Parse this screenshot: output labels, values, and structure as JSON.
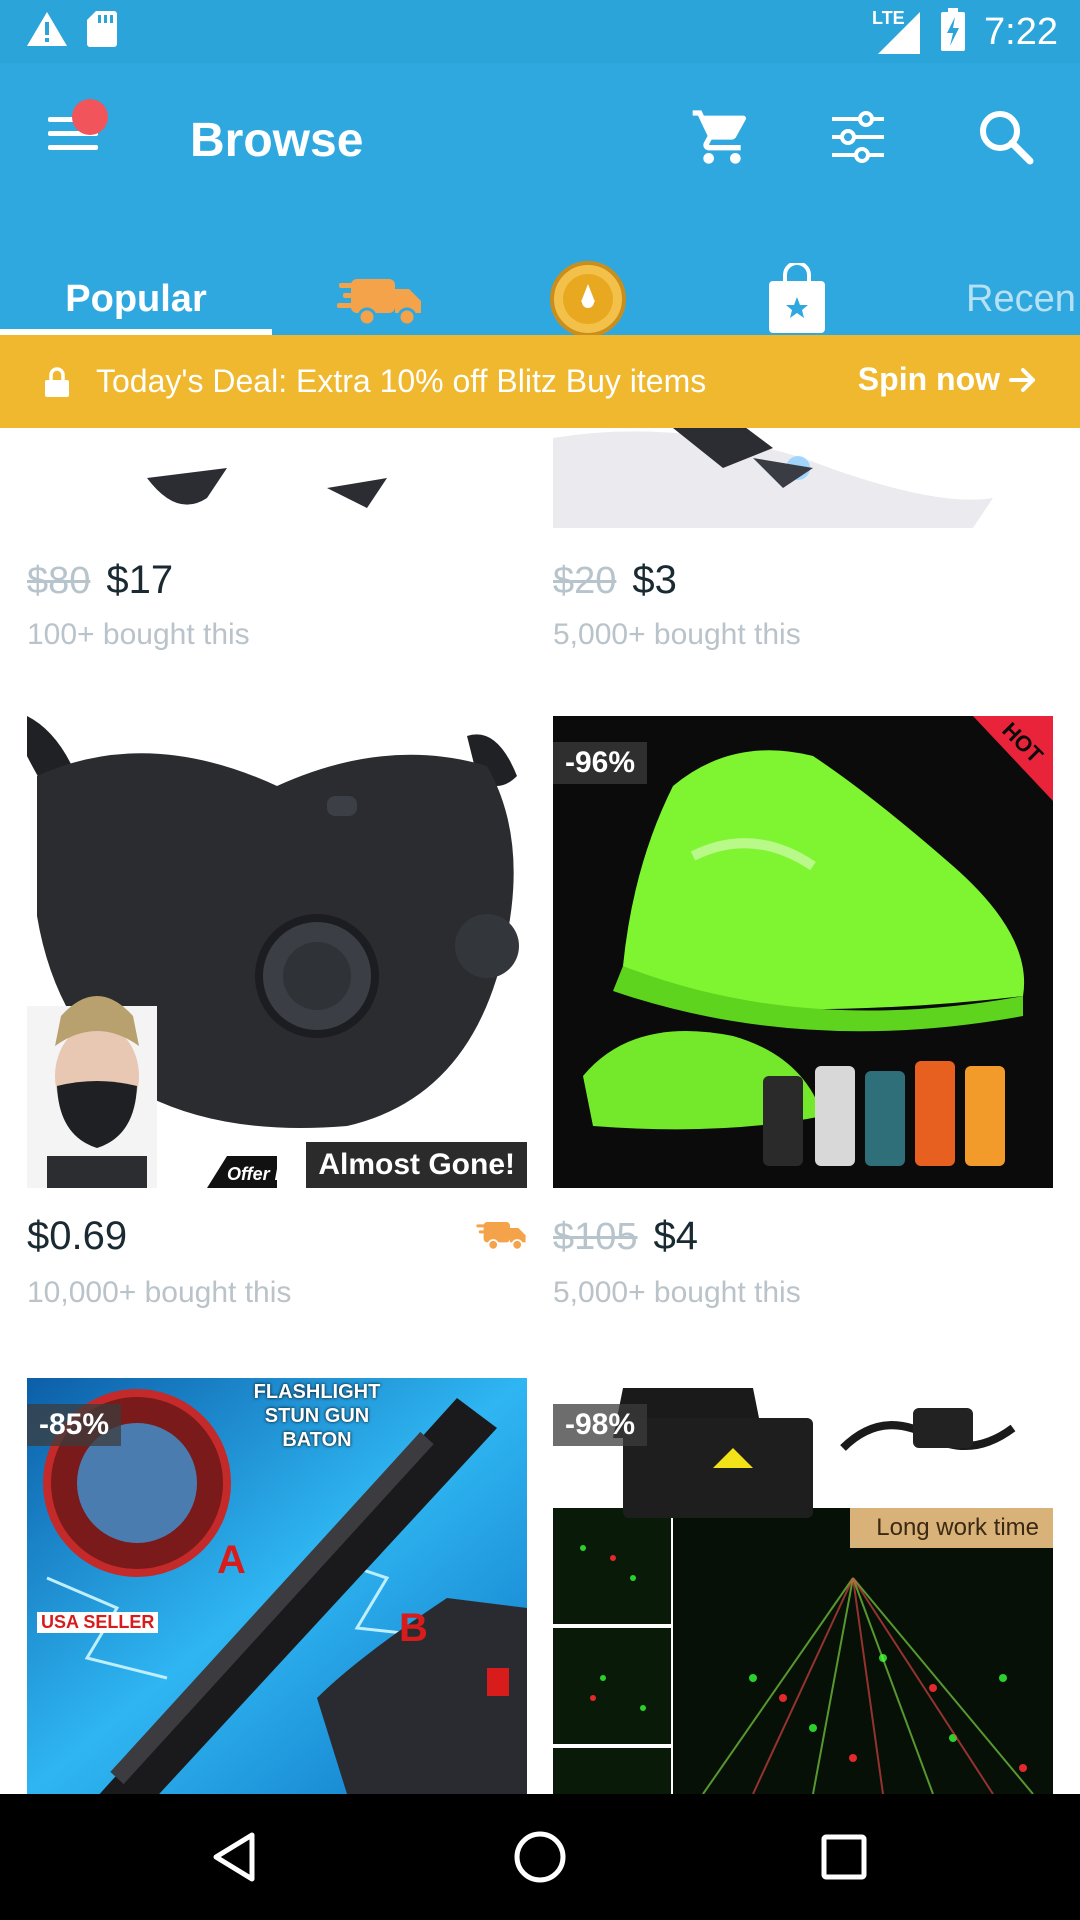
{
  "status_bar": {
    "time": "7:22",
    "network": "LTE",
    "icons": [
      "warning-icon",
      "sd-card-icon",
      "signal-icon",
      "battery-charging-icon"
    ]
  },
  "app_bar": {
    "title": "Browse",
    "icons": [
      "menu-icon",
      "cart-icon",
      "filter-icon",
      "search-icon"
    ],
    "notification_dot_color": "#f2545b"
  },
  "tabs": [
    {
      "label": "Popular",
      "active": true
    },
    {
      "icon": "fast-shipping-truck-icon"
    },
    {
      "icon": "blitz-buy-coin-icon"
    },
    {
      "icon": "shopping-bag-star-icon"
    },
    {
      "label": "Recen"
    }
  ],
  "deal_banner": {
    "text": "Today's Deal: Extra 10% off Blitz Buy items",
    "cta": "Spin now",
    "color": "#f0b82e"
  },
  "products": [
    {
      "old_price": "$80",
      "price": "$17",
      "bought": "100+ bought this"
    },
    {
      "old_price": "$20",
      "price": "$3",
      "bought": "5,000+ bought this"
    },
    {
      "price": "$0.69",
      "bought": "10,000+ bought this",
      "label": "Almost Gone!",
      "image_text": "Offer B",
      "fast_shipping": true
    },
    {
      "old_price": "$105",
      "price": "$4",
      "bought": "5,000+ bought this",
      "badge": "-96%",
      "corner_tag": "HOT"
    },
    {
      "badge": "-85%",
      "image_text": [
        "FLASHLIGHT",
        "STUN GUN",
        "BATON"
      ],
      "image_labels": [
        "A",
        "B",
        "USA SELLER"
      ]
    },
    {
      "badge": "-98%",
      "tag": "Long work time"
    }
  ],
  "nav_bar": {
    "icons": [
      "back-icon",
      "home-icon",
      "recents-icon"
    ]
  },
  "colors": {
    "primary": "#2fa8e0",
    "status_bar": "#2aa4d9",
    "accent_orange": "#f5a34a"
  }
}
